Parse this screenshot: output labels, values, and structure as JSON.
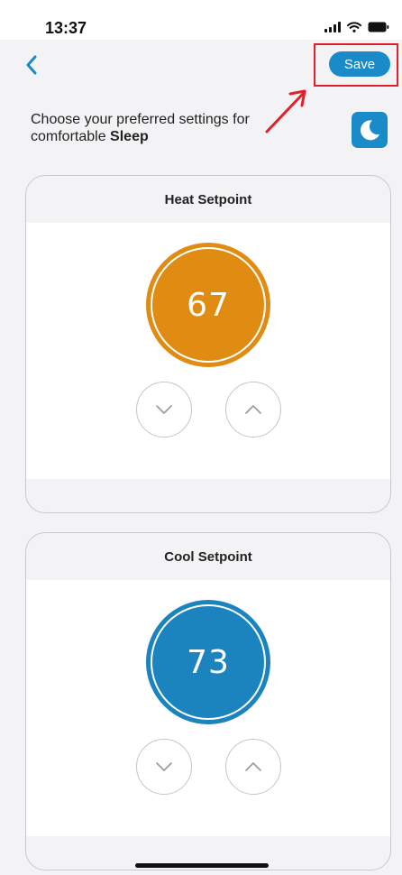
{
  "status_bar": {
    "time": "13:37",
    "icons": [
      "signal-icon",
      "wifi-icon",
      "battery-icon"
    ]
  },
  "nav": {
    "back_icon": "chevron-left-icon",
    "save_label": "Save"
  },
  "intro": {
    "text": "Choose your preferred settings for comfortable ",
    "mode": "Sleep",
    "mode_icon": "moon-icon"
  },
  "heat": {
    "title": "Heat Setpoint",
    "value": "67",
    "color": "#e08b12",
    "down_icon": "chevron-down-icon",
    "up_icon": "chevron-up-icon"
  },
  "cool": {
    "title": "Cool Setpoint",
    "value": "73",
    "color": "#1b83bd",
    "down_icon": "chevron-down-icon",
    "up_icon": "chevron-up-icon"
  },
  "colors": {
    "accent": "#1a8bc9",
    "annotation": "#e3202a"
  }
}
